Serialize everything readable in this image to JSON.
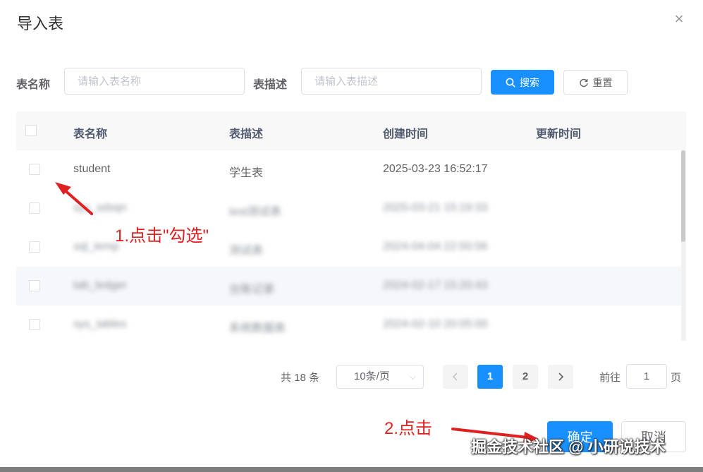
{
  "dialog": {
    "title": "导入表",
    "close_glyph": "×"
  },
  "search": {
    "table_name_label": "表名称",
    "table_name_placeholder": "请输入表名称",
    "table_desc_label": "表描述",
    "table_desc_placeholder": "请输入表描述",
    "search_button": "搜索",
    "reset_button": "重置"
  },
  "table": {
    "columns": [
      "表名称",
      "表描述",
      "创建时间",
      "更新时间"
    ],
    "rows": [
      {
        "name": "student",
        "desc": "学生表",
        "created": "2025-03-23 16:52:17",
        "updated": ""
      },
      {
        "name": "sys_sdsqn",
        "desc": "test测试表",
        "created": "2025-03-21 15:19:33",
        "updated": ""
      },
      {
        "name": "sql_temp",
        "desc": "测试表",
        "created": "2024-04-04 22:50:56",
        "updated": ""
      },
      {
        "name": "tab_ledger",
        "desc": "台账记录",
        "created": "2024-02-17 15:20:43",
        "updated": ""
      },
      {
        "name": "sys_tables",
        "desc": "系统数据表",
        "created": "2024-02-10 20:05:00",
        "updated": ""
      }
    ]
  },
  "pagination": {
    "total_text": "共 18 条",
    "page_size": "10条/页",
    "pages": [
      "1",
      "2"
    ],
    "current_page": "1",
    "goto_label": "前往",
    "goto_value": "1",
    "page_suffix": "页"
  },
  "footer": {
    "confirm_button": "确定",
    "cancel_button": "取消"
  },
  "annotations": {
    "step1": "1.点击\"勾选\"",
    "step2": "2.点击"
  },
  "watermark": "掘金技术社区 @ 小研说技术",
  "colors": {
    "primary": "#1890ff",
    "annotation": "#e02020",
    "header_bg": "#f8f8f9",
    "hover_row": "#f5f7fa"
  }
}
